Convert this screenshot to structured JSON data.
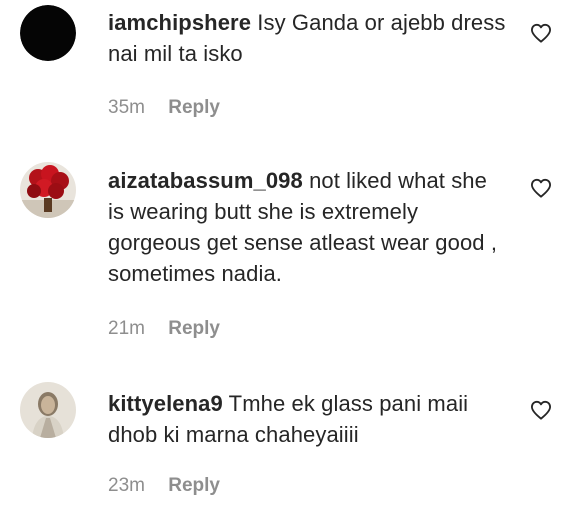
{
  "comments": [
    {
      "username": "iamchipshere",
      "text": "Isy Ganda or ajebb dress nai mil ta isko",
      "time": "35m",
      "reply_label": "Reply",
      "avatar_icon": "black-circle-avatar",
      "like_icon": "heart-outline-icon"
    },
    {
      "username": "aizatabassum_098",
      "text": "not liked what she is wearing butt she is extremely gorgeous get sense atleast wear good , sometimes nadia.",
      "time": "21m",
      "reply_label": "Reply",
      "avatar_icon": "red-roses-avatar",
      "like_icon": "heart-outline-icon"
    },
    {
      "username": "kittyelena9",
      "text": "Tmhe ek glass pani maii dhob ki marna chaheyaiiii",
      "time": "23m",
      "reply_label": "Reply",
      "avatar_icon": "woman-portrait-avatar",
      "like_icon": "heart-outline-icon"
    }
  ],
  "colors": {
    "text": "#262626",
    "meta": "#8e8e8e",
    "background": "#ffffff"
  }
}
